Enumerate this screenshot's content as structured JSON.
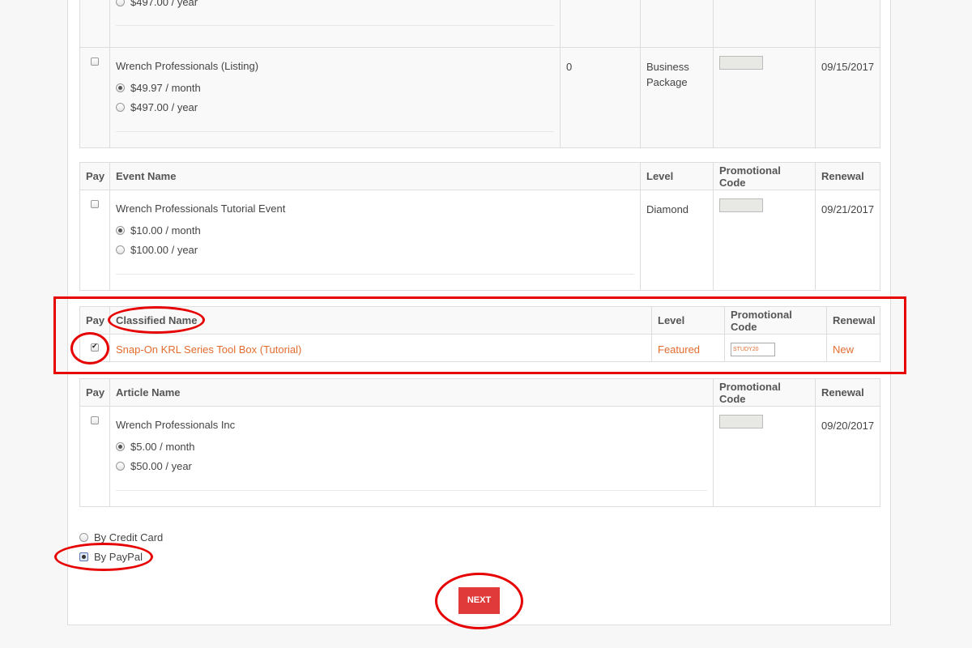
{
  "listing_table": {
    "partial_row": {
      "option_year": "$497.00 / year"
    },
    "row": {
      "name": "Wrench Professionals (Listing)",
      "options": [
        "$49.97 / month",
        "$497.00 / year"
      ],
      "count": "0",
      "level": "Business Package",
      "renewal": "09/15/2017"
    }
  },
  "event_table": {
    "headers": {
      "pay": "Pay",
      "name": "Event Name",
      "level": "Level",
      "promo": "Promotional Code",
      "renewal": "Renewal"
    },
    "row": {
      "name": "Wrench Professionals Tutorial Event",
      "options": [
        "$10.00 / month",
        "$100.00 / year"
      ],
      "level": "Diamond",
      "renewal": "09/21/2017"
    }
  },
  "classified_table": {
    "headers": {
      "pay": "Pay",
      "name": "Classified Name",
      "level": "Level",
      "promo": "Promotional Code",
      "renewal": "Renewal"
    },
    "row": {
      "name": "Snap-On KRL Series Tool Box (Tutorial)",
      "level": "Featured",
      "promo_code": "STUDY20",
      "renewal": "New",
      "checked": true
    }
  },
  "article_table": {
    "headers": {
      "pay": "Pay",
      "name": "Article Name",
      "promo": "Promotional Code",
      "renewal": "Renewal"
    },
    "row": {
      "name": "Wrench Professionals Inc",
      "options": [
        "$5.00 / month",
        "$50.00 / year"
      ],
      "renewal": "09/20/2017"
    }
  },
  "payment": {
    "credit_card": "By Credit Card",
    "paypal": "By PayPal",
    "selected": "paypal"
  },
  "next_button": "NEXT",
  "colors": {
    "accent": "#e03a3a",
    "link": "#e36c2f",
    "annotation": "#e60000"
  }
}
